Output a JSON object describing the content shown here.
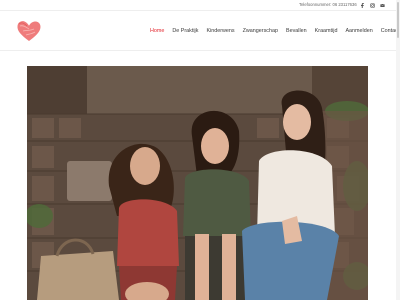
{
  "topbar": {
    "phone": "Telefoonnummer: 06 23117636",
    "social": [
      "facebook-icon",
      "instagram-icon",
      "mail-icon"
    ]
  },
  "nav": {
    "items": [
      {
        "label": "Home",
        "active": true
      },
      {
        "label": "De Praktijk",
        "active": false
      },
      {
        "label": "Kinderwens",
        "active": false
      },
      {
        "label": "Zwangerschap",
        "active": false
      },
      {
        "label": "Bevallen",
        "active": false
      },
      {
        "label": "Kraamtijd",
        "active": false
      },
      {
        "label": "Aanmelden",
        "active": false
      },
      {
        "label": "Contact",
        "active": false
      }
    ]
  },
  "colors": {
    "accent": "#e3262e",
    "logo": "#ef7c7c",
    "text": "#3a3a3a"
  },
  "hero": {
    "description_icon": "photo-three-women-on-steps"
  }
}
